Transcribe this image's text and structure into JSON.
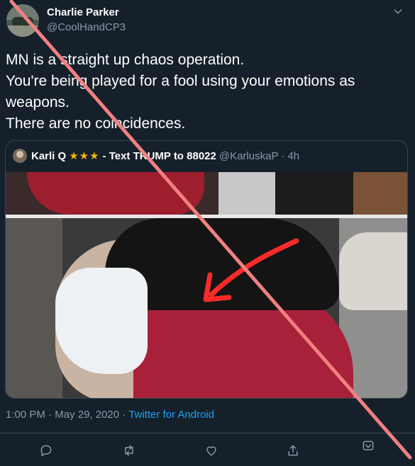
{
  "tweet": {
    "display_name": "Charlie Parker",
    "handle": "@CoolHandCP3",
    "text": "MN is a straight up chaos operation.\nYou're being played for a fool using your emotions as weapons.\nThere are no coincidences.",
    "time": "1:00 PM",
    "date": "May 29, 2020",
    "source": "Twitter for Android"
  },
  "quote": {
    "name": "Karli Q",
    "stars": "★★★",
    "text": "- Text TRUMP to 88022",
    "handle": "@KarluskaP",
    "age": "4h"
  },
  "icons": {
    "more": "chevron-down-icon",
    "reply": "reply-icon",
    "retweet": "retweet-icon",
    "like": "heart-icon",
    "share": "share-icon"
  },
  "colors": {
    "background": "#15202b",
    "secondary_text": "#8899a6",
    "link": "#1da1f2",
    "border": "#38444d",
    "overlay_line": "#f08080"
  }
}
